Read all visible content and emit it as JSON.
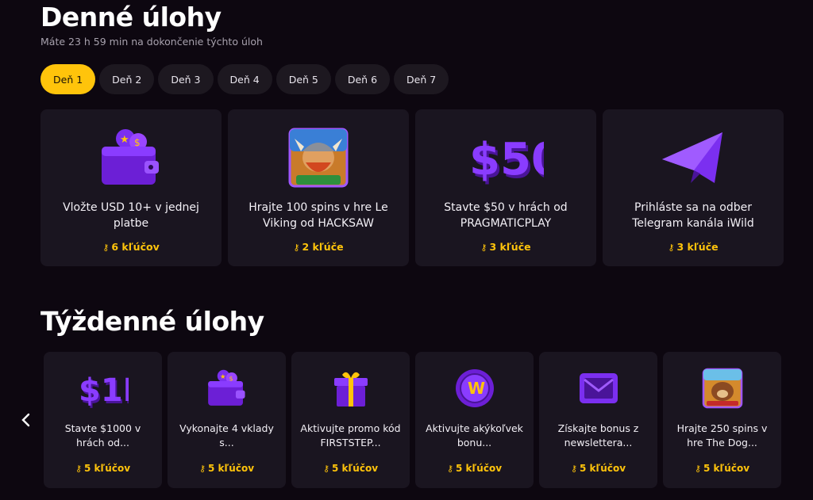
{
  "daily": {
    "title": "Denné úlohy",
    "subtitle": "Máte 23 h 59 min na dokončenie týchto úloh",
    "tabs": [
      "Deň 1",
      "Deň 2",
      "Deň 3",
      "Deň 4",
      "Deň 5",
      "Deň 6",
      "Deň 7"
    ],
    "active_tab": 0,
    "cards": [
      {
        "icon": "wallet-icon",
        "text": "Vložte USD 10+ v jednej platbe",
        "keys": "6 kľúčov"
      },
      {
        "icon": "le-viking-game-thumbnail",
        "text": "Hrajte 100 spins v hre Le Viking od HACKSAW",
        "keys": "2 kľúče"
      },
      {
        "icon": "dollar-50-icon",
        "text": "Stavte $50 v hrách od PRAGMATICPLAY",
        "keys": "3 kľúče"
      },
      {
        "icon": "telegram-icon",
        "text": "Prihláste sa na odber Telegram kanála iWild",
        "keys": "3 kľúče"
      }
    ]
  },
  "weekly": {
    "title": "Týždenné úlohy",
    "cards": [
      {
        "icon": "dollar-1k-icon",
        "text": "Stavte $1000 v hrách od...",
        "keys": "5 kľúčov"
      },
      {
        "icon": "wallet-icon",
        "text": "Vykonajte 4 vklady s...",
        "keys": "5 kľúčov"
      },
      {
        "icon": "gift-icon",
        "text": "Aktivujte promo kód FIRSTSTEP...",
        "keys": "5 kľúčov"
      },
      {
        "icon": "coin-w-icon",
        "text": "Aktivujte akýkoľvek bonu...",
        "keys": "5 kľúčov"
      },
      {
        "icon": "mail-icon",
        "text": "Získajte bonus z newslettera...",
        "keys": "5 kľúčov"
      },
      {
        "icon": "the-dog-house-game-thumbnail",
        "text": "Hrajte 250 spins v hre The Dog...",
        "keys": "5 kľúčov"
      }
    ]
  },
  "theme": {
    "accent": "#ffc40b",
    "card_bg": "#1a1520",
    "page_bg": "#0d0710",
    "purple": "#8a2be2"
  }
}
